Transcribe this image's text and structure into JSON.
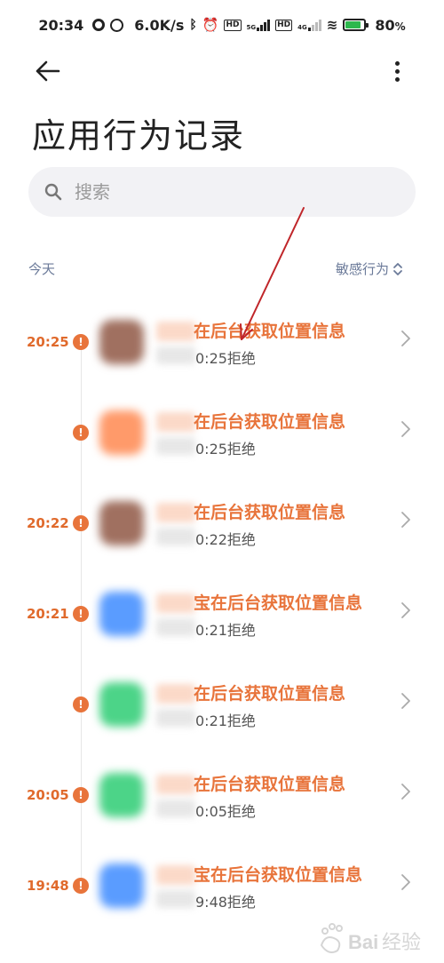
{
  "status_bar": {
    "time": "20:34",
    "speed": "6.0K/s",
    "battery": "80",
    "battery_unit": "%",
    "hd1": "HD",
    "hd2": "HD",
    "net1": "5G",
    "net2": "4G"
  },
  "header": {
    "title": "应用行为记录"
  },
  "search": {
    "placeholder": "搜索"
  },
  "section": {
    "day": "今天",
    "filter_label": "敏感行为"
  },
  "colors": {
    "accent": "#e8743b",
    "time_text": "#e06a2c",
    "muted": "#6b7a99",
    "search_bg": "#f2f2f5"
  },
  "records": [
    {
      "time": "20:25",
      "title": "在后台获取位置信息",
      "sub": "0:25拒绝",
      "icon_color": "#a07060"
    },
    {
      "time": "",
      "title": "在后台获取位置信息",
      "sub": "0:25拒绝",
      "icon_color": "#ff9a6a"
    },
    {
      "time": "20:22",
      "title": "在后台获取位置信息",
      "sub": "0:22拒绝",
      "icon_color": "#a07060"
    },
    {
      "time": "20:21",
      "title": "宝在后台获取位置信息",
      "sub": "0:21拒绝",
      "icon_color": "#5a9cff"
    },
    {
      "time": "",
      "title": "在后台获取位置信息",
      "sub": "0:21拒绝",
      "icon_color": "#4cd488"
    },
    {
      "time": "20:05",
      "title": "在后台获取位置信息",
      "sub": "0:05拒绝",
      "icon_color": "#4cd488"
    },
    {
      "time": "19:48",
      "title": "宝在后台获取位置信息",
      "sub": "9:48拒绝",
      "icon_color": "#5a9cff"
    }
  ]
}
